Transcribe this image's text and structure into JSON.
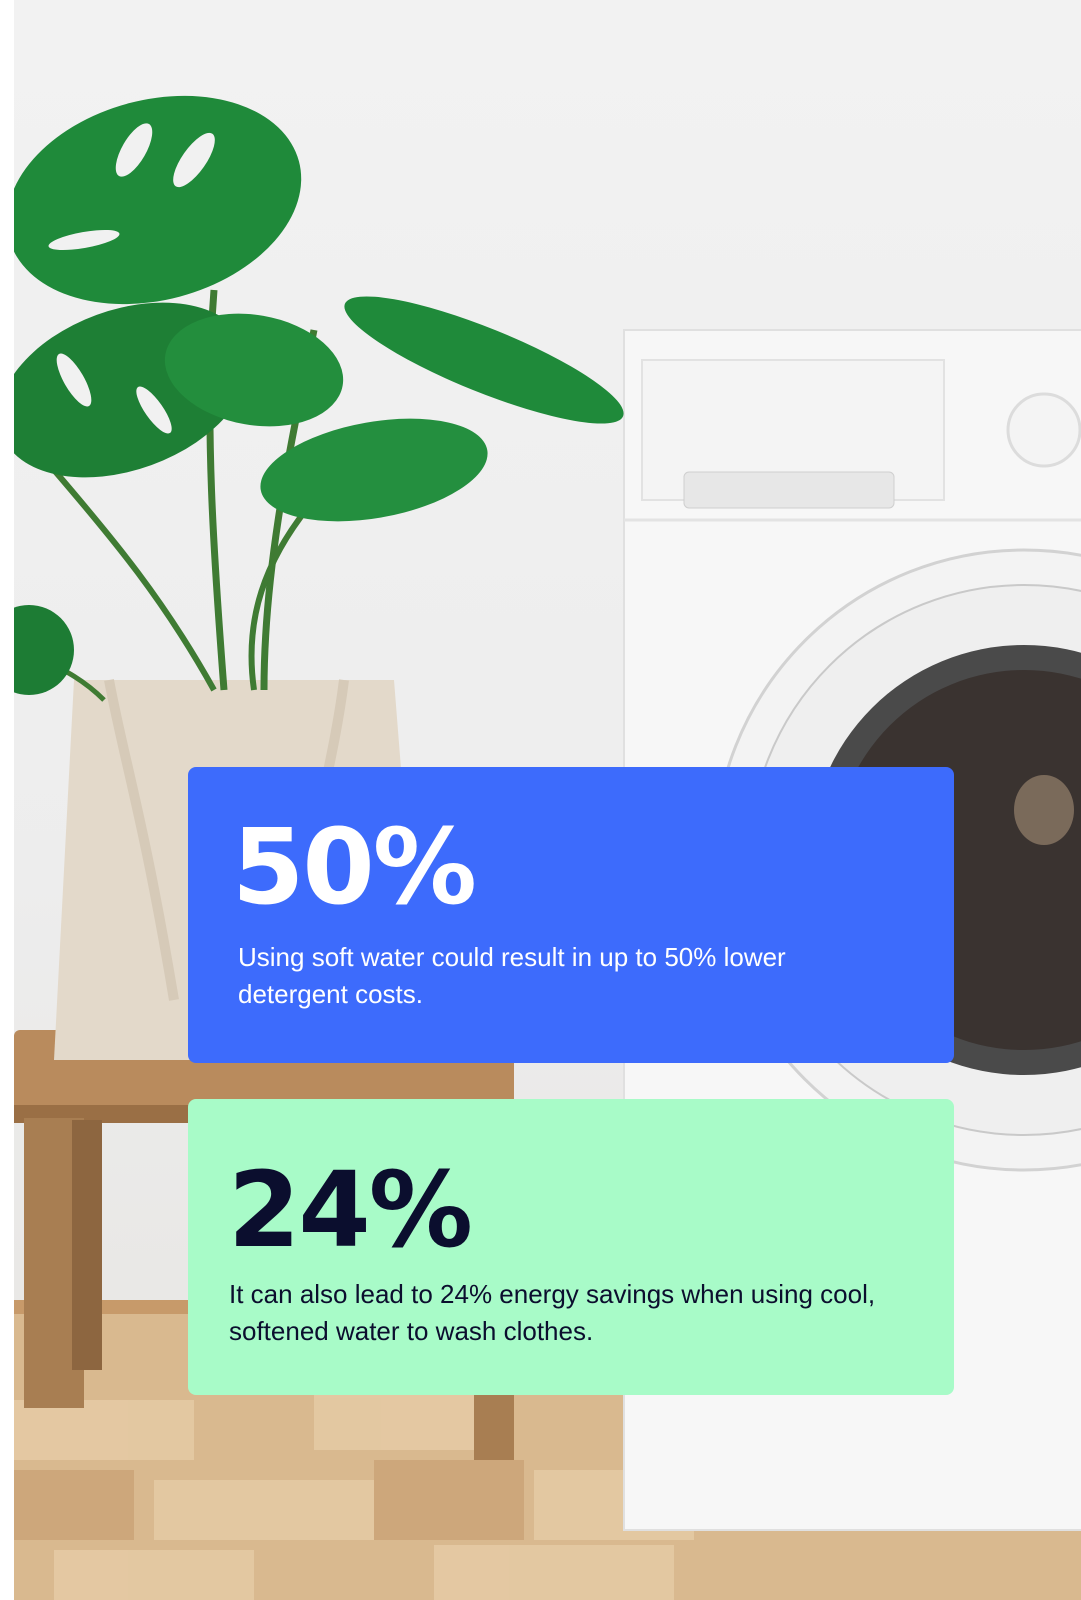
{
  "colors": {
    "blue_card": "#3d6bfc",
    "green_card": "#a8fbc8",
    "dark_text": "#0b0e2e",
    "light_text": "#ffffff"
  },
  "background": {
    "image": "laundry-room-photo",
    "elements": [
      "monstera-plant-icon",
      "cloth-bag",
      "wooden-stool",
      "washing-machine",
      "wooden-floor"
    ]
  },
  "stats": [
    {
      "value": "50%",
      "description": "Using soft water could result in up to 50% lower detergent costs."
    },
    {
      "value": "24%",
      "description": "It can also lead to 24% energy savings when using cool, softened water to wash clothes."
    }
  ]
}
